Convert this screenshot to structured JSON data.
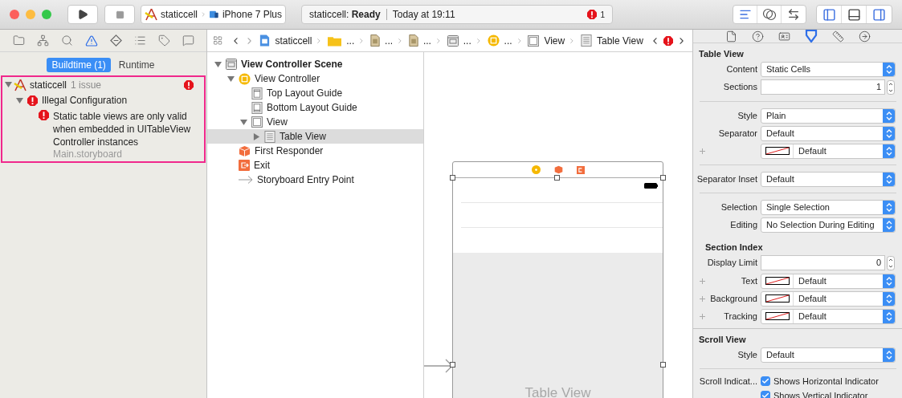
{
  "toolbar": {
    "scheme": {
      "project": "staticcell",
      "device": "iPhone 7 Plus"
    },
    "activity": {
      "status": "staticcell: **Ready**",
      "time": "Today at 19:11",
      "issue_count": "1"
    }
  },
  "navigator": {
    "tabs": [
      {
        "kind": "folder",
        "selected": false
      },
      {
        "kind": "hierarchy",
        "selected": false
      },
      {
        "kind": "search",
        "selected": false
      },
      {
        "kind": "warning",
        "selected": true
      },
      {
        "kind": "diamond",
        "selected": false
      },
      {
        "kind": "list",
        "selected": false
      },
      {
        "kind": "tag",
        "selected": false
      },
      {
        "kind": "chat",
        "selected": false
      }
    ],
    "segments": [
      {
        "label": "Buildtime (1)",
        "selected": true
      },
      {
        "label": "Runtime",
        "selected": false
      }
    ],
    "issues": {
      "project": "staticcell",
      "count": "1 issue",
      "expanded": true,
      "groups": [
        {
          "label": "Illegal Configuration",
          "expanded": true,
          "messages": [
            {
              "text": "Static table views are only valid when embedded in UITableView Controller instances",
              "file": "Main.storyboard"
            }
          ]
        }
      ]
    }
  },
  "breadcrumb": [
    {
      "kind": "project",
      "label": "staticcell"
    },
    {
      "kind": "folder",
      "label": "..."
    },
    {
      "kind": "file",
      "label": "..."
    },
    {
      "kind": "file",
      "label": "..."
    },
    {
      "kind": "scene",
      "label": "..."
    },
    {
      "kind": "controller",
      "label": "..."
    },
    {
      "kind": "view",
      "label": "View"
    },
    {
      "kind": "table",
      "label": "Table View"
    }
  ],
  "outline": [
    {
      "kind": "scene",
      "label": "View Controller Scene",
      "expanded": true,
      "selected": false,
      "children": [
        {
          "kind": "controller",
          "label": "View Controller",
          "expanded": true,
          "selected": false,
          "children": [
            {
              "kind": "top-guide",
              "label": "Top Layout Guide",
              "selected": false
            },
            {
              "kind": "bottom-guide",
              "label": "Bottom Layout Guide",
              "selected": false
            },
            {
              "kind": "view",
              "label": "View",
              "expanded": true,
              "selected": false,
              "children": [
                {
                  "kind": "table",
                  "label": "Table View",
                  "expanded": false,
                  "selected": true
                }
              ]
            }
          ]
        },
        {
          "kind": "responder",
          "label": "First Responder",
          "selected": false
        },
        {
          "kind": "exit",
          "label": "Exit",
          "selected": false
        },
        {
          "kind": "entry",
          "label": "Storyboard Entry Point",
          "selected": false
        }
      ]
    }
  ],
  "canvas": {
    "placeholder_label": "Table View"
  },
  "inspector": {
    "tabs": [
      {
        "kind": "file",
        "selected": false
      },
      {
        "kind": "help",
        "selected": false
      },
      {
        "kind": "identity",
        "selected": false
      },
      {
        "kind": "attributes",
        "selected": true
      },
      {
        "kind": "size",
        "selected": false
      },
      {
        "kind": "connections",
        "selected": false
      }
    ],
    "sections": [
      {
        "title": "Table View",
        "indent": false,
        "rows": [
          {
            "kind": "popup",
            "label": "Content",
            "value": "Static Cells"
          },
          {
            "kind": "stepper",
            "label": "Sections",
            "value": "1"
          },
          {
            "kind": "divider"
          },
          {
            "kind": "popup",
            "label": "Style",
            "value": "Plain"
          },
          {
            "kind": "popup",
            "label": "Separator",
            "value": "Default"
          },
          {
            "kind": "color",
            "value": "Default"
          },
          {
            "kind": "divider"
          },
          {
            "kind": "popup",
            "label": "Separator Inset",
            "value": "Default"
          },
          {
            "kind": "divider"
          },
          {
            "kind": "popup",
            "label": "Selection",
            "value": "Single Selection"
          },
          {
            "kind": "popup",
            "label": "Editing",
            "value": "No Selection During Editing"
          }
        ]
      },
      {
        "title": "Section Index",
        "indent": true,
        "rows": [
          {
            "kind": "stepper",
            "label": "Display Limit",
            "value": "0"
          },
          {
            "kind": "color",
            "label": "Text",
            "value": "Default"
          },
          {
            "kind": "color",
            "label": "Background",
            "value": "Default"
          },
          {
            "kind": "color",
            "label": "Tracking",
            "value": "Default"
          }
        ]
      },
      {
        "title": "Scroll View",
        "indent": false,
        "rows": [
          {
            "kind": "popup",
            "label": "Style",
            "value": "Default"
          },
          {
            "kind": "divider"
          },
          {
            "kind": "checkbox",
            "label": "Scroll Indicat...",
            "text": "Shows Horizontal Indicator",
            "checked": true
          },
          {
            "kind": "checkbox",
            "text": "Shows Vertical Indicator",
            "checked": true
          }
        ]
      }
    ]
  }
}
